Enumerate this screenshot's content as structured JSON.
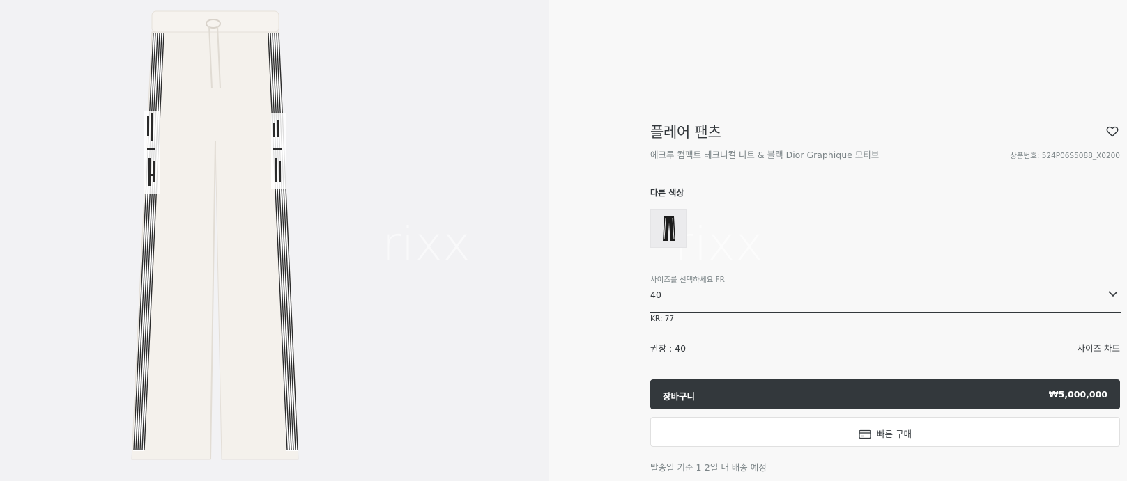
{
  "product": {
    "title": "플레어 팬츠",
    "subtitle": "에크루 컴팩트 테크니컬 니트 & 블랙 Dior Graphique 모티브",
    "reference": "상품번호: 524P06S5088_X0200"
  },
  "colors": {
    "label": "다른 색상"
  },
  "size": {
    "label": "사이즈를 선택하세요 FR",
    "value": "40",
    "kr": "KR: 77",
    "recommended": "권장 : 40",
    "chart_link": "사이즈 차트"
  },
  "cart": {
    "label": "장바구니",
    "price": "₩5,000,000"
  },
  "quick_buy": {
    "label": "빠른 구매"
  },
  "delivery": "발송일 기준 1-2일 내 배송 예정",
  "watermark": "rixx",
  "icons": [
    "heart-icon",
    "chevron-down-icon",
    "credit-card-icon"
  ],
  "colors_palette": {
    "background_left": "#f2f2f4",
    "background_right": "#f8f8f8",
    "text_primary": "#33383c",
    "text_secondary": "#7b8487",
    "button_dark": "#33383c"
  }
}
